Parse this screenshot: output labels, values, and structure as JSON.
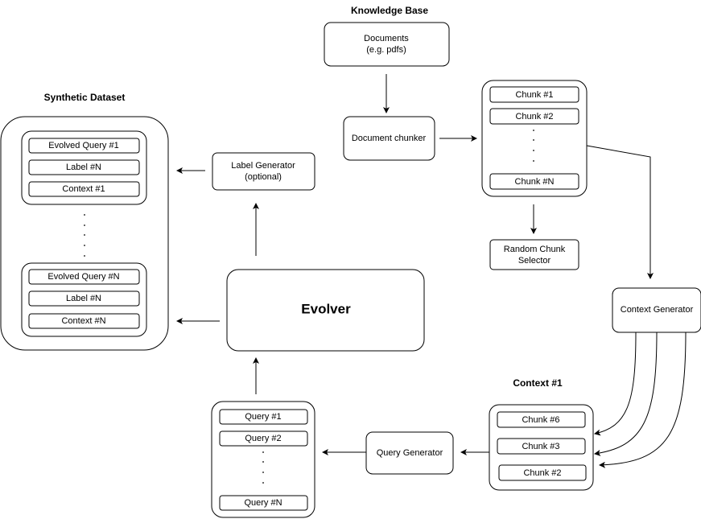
{
  "knowledge_base": {
    "title": "Knowledge Base",
    "documents_line1": "Documents",
    "documents_line2": "(e.g. pdfs)",
    "chunker": "Document chunker"
  },
  "chunks": {
    "items": [
      "Chunk #1",
      "Chunk #2",
      "Chunk #N"
    ]
  },
  "random_chunk_selector": {
    "line1": "Random Chunk",
    "line2": "Selector"
  },
  "context_generator": "Context Generator",
  "context": {
    "title": "Context #1",
    "items": [
      "Chunk #6",
      "Chunk #3",
      "Chunk #2"
    ]
  },
  "query_generator": "Query Generator",
  "queries": {
    "items": [
      "Query #1",
      "Query #2",
      "Query #N"
    ]
  },
  "evolver": "Evolver",
  "label_generator": {
    "line1": "Label Generator",
    "line2": "(optional)"
  },
  "synthetic_dataset": {
    "title": "Synthetic Dataset",
    "first": [
      "Evolved Query #1",
      "Label #N",
      "Context #1"
    ],
    "last": [
      "Evolved Query #N",
      "Label #N",
      "Context #N"
    ]
  }
}
